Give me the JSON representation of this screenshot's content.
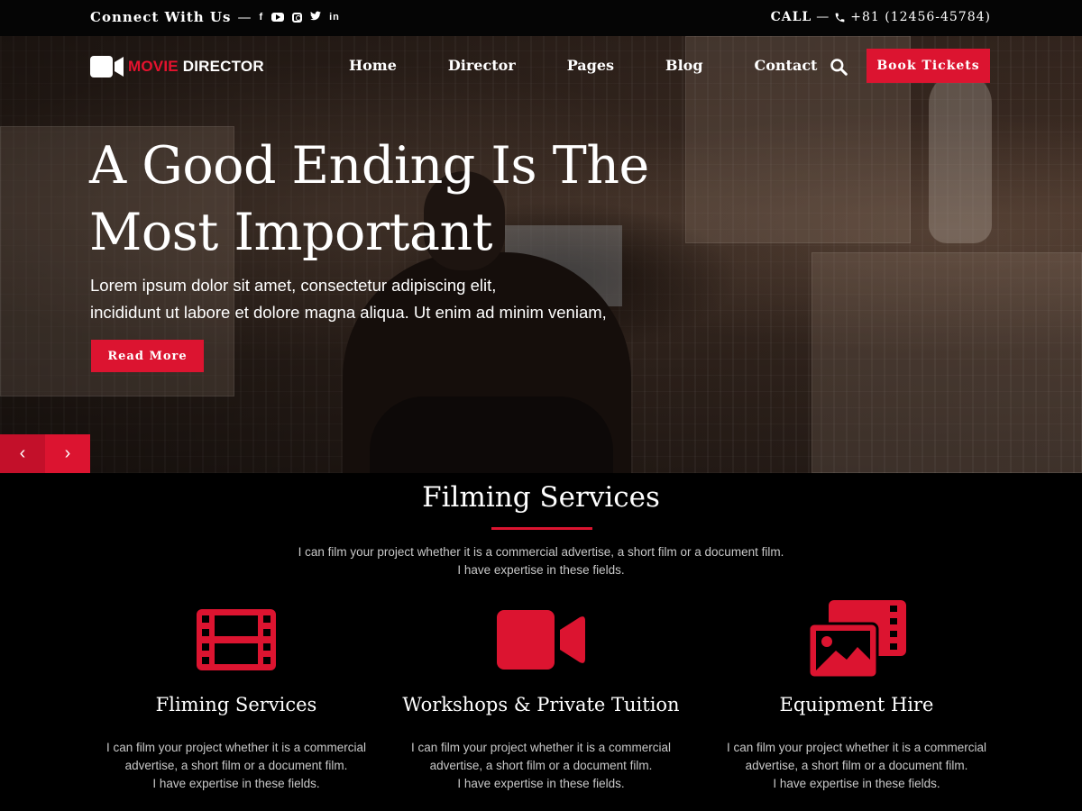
{
  "topbar": {
    "connect_label": "Connect With Us",
    "dash": "—",
    "social_icons": [
      "facebook-icon",
      "youtube-icon",
      "instagram-icon",
      "twitter-icon",
      "linkedin-icon"
    ],
    "call_label": "CALL",
    "phone": "+81 (12456-45784)"
  },
  "nav": {
    "logo": {
      "part1": "MOVIE",
      "part2": " DIRECTOR"
    },
    "items": [
      {
        "label": "Home"
      },
      {
        "label": "Director"
      },
      {
        "label": "Pages"
      },
      {
        "label": "Blog"
      },
      {
        "label": "Contact"
      }
    ],
    "cta": "Book Tickets"
  },
  "hero": {
    "title": "A Good Ending Is The Most Important",
    "line1": "Lorem ipsum dolor sit amet, consectetur adipiscing elit,",
    "line2": "incididunt ut labore et dolore magna aliqua. Ut enim ad minim veniam,",
    "button": "Read More",
    "prev": "‹",
    "next": "›"
  },
  "services": {
    "title": "Filming Services",
    "desc1": "I can film your project whether it is a commercial advertise, a short film or a document film.",
    "desc2": "I have expertise in these fields.",
    "cards": [
      {
        "icon": "film-strip-icon",
        "title": "Fliming Services",
        "line1": "I can film your project whether it is a commercial",
        "line2": "advertise, a short film or a document film.",
        "line3": "I have expertise in these fields."
      },
      {
        "icon": "video-camera-icon",
        "title": "Workshops & Private Tuition",
        "line1": "I can film your project whether it is a commercial",
        "line2": "advertise, a short film or a document film.",
        "line3": "I have expertise in these fields."
      },
      {
        "icon": "photo-film-icon",
        "title": "Equipment Hire",
        "line1": "I can film your project whether it is a commercial",
        "line2": "advertise, a short film or a document film.",
        "line3": "I have expertise in these fields."
      }
    ]
  },
  "colors": {
    "accent": "#dc1430",
    "background": "#000000",
    "text": "#ffffff",
    "muted": "#c8c8c8"
  }
}
